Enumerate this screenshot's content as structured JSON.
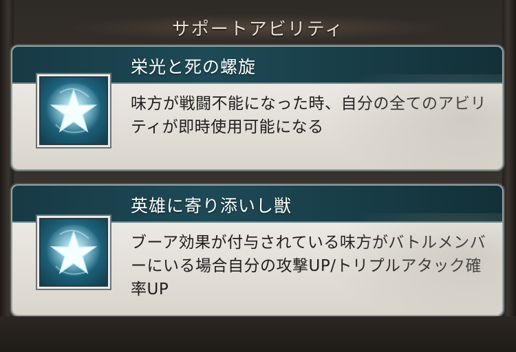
{
  "header": {
    "title": "サポートアビリティ"
  },
  "abilities": [
    {
      "name": "栄光と死の螺旋",
      "description": "味方が戦闘不能になった時、自分の全てのアビリティが即時使用可能になる",
      "icon": "star-icon"
    },
    {
      "name": "英雄に寄り添いし獣",
      "description": "ブーア効果が付与されている味方がバトルメンバーにいる場合自分の攻撃UP/トリプルアタック確率UP",
      "icon": "star-icon"
    }
  ],
  "colors": {
    "band": "#1d4a56",
    "card": "#e6e3dc",
    "icon_glow": "#4fb5d8",
    "background": "#3a3530"
  }
}
